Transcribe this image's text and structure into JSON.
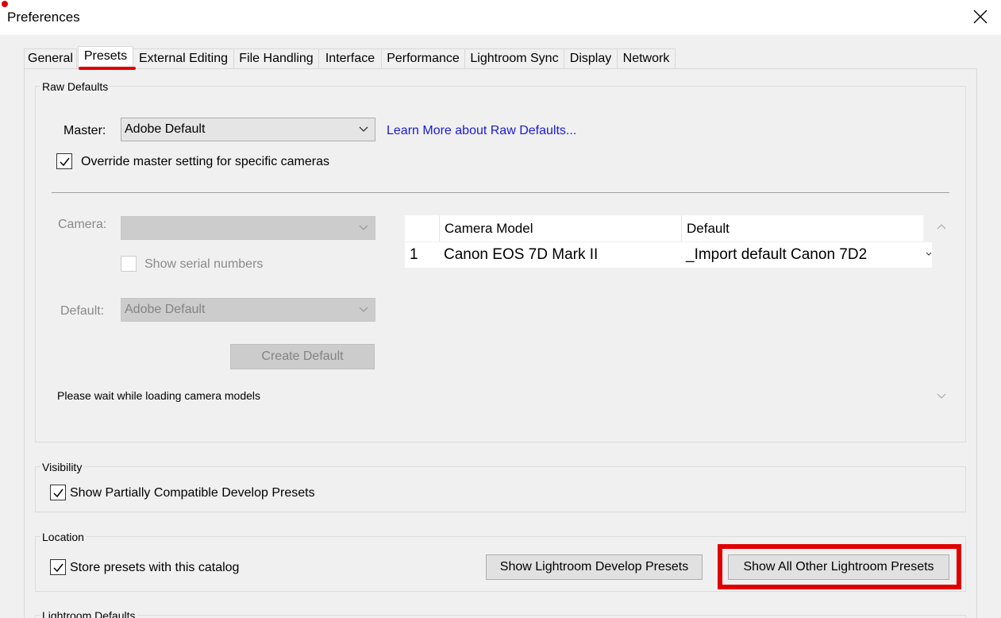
{
  "window": {
    "title": "Preferences"
  },
  "tabs": [
    {
      "label": "General"
    },
    {
      "label": "Presets"
    },
    {
      "label": "External Editing"
    },
    {
      "label": "File Handling"
    },
    {
      "label": "Interface"
    },
    {
      "label": "Performance"
    },
    {
      "label": "Lightroom Sync"
    },
    {
      "label": "Display"
    },
    {
      "label": "Network"
    }
  ],
  "raw_defaults": {
    "group_label": "Raw Defaults",
    "master_label": "Master:",
    "master_value": "Adobe Default",
    "learn_more_link": "Learn More about Raw Defaults...",
    "override_label": "Override master setting for specific cameras",
    "override_checked": true,
    "camera_label": "Camera:",
    "camera_value": "",
    "show_serial_label": "Show serial numbers",
    "default_label": "Default:",
    "default_value": "Adobe Default",
    "create_default_button": "Create Default",
    "status": "Please wait while loading camera models",
    "table": {
      "columns": [
        "Camera Model",
        "Default"
      ],
      "rows": [
        {
          "index": "1",
          "camera_model": "Canon EOS 7D Mark II",
          "default": "_Import default Canon 7D2"
        }
      ]
    }
  },
  "visibility": {
    "group_label": "Visibility",
    "show_partial_label": "Show Partially Compatible Develop Presets",
    "show_partial_checked": true
  },
  "location": {
    "group_label": "Location",
    "store_label": "Store presets with this catalog",
    "store_checked": true,
    "show_develop_button": "Show Lightroom Develop Presets",
    "show_all_button": "Show All Other Lightroom Presets"
  },
  "lightroom_defaults": {
    "group_label": "Lightroom Defaults"
  },
  "colors": {
    "highlight": "#e00000",
    "link": "#1a1ad6"
  },
  "icons": {
    "close": "close-icon",
    "dropdown": "chevron-down-icon",
    "check": "check-icon",
    "scroll_up": "chevron-up-icon",
    "scroll_down": "chevron-down-icon"
  }
}
